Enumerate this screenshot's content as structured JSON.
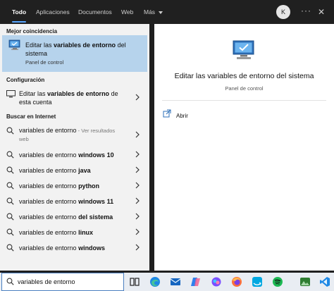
{
  "tabs": [
    {
      "label": "Todo",
      "active": true
    },
    {
      "label": "Aplicaciones"
    },
    {
      "label": "Documentos"
    },
    {
      "label": "Web"
    },
    {
      "label": "Más"
    }
  ],
  "user_initial": "K",
  "more_glyph": "···",
  "close_glyph": "✕",
  "sections": {
    "best_match": "Mejor coincidencia",
    "settings": "Configuración",
    "web": "Buscar en Internet"
  },
  "best_match": {
    "title_pre": "Editar las ",
    "title_bold": "variables de entorno",
    "title_post": " del sistema",
    "subtitle": "Panel de control"
  },
  "settings_item": {
    "title_pre": "Editar las ",
    "title_bold": "variables de entorno",
    "title_post": " de esta cuenta"
  },
  "web_results": [
    {
      "prefix": "variables de entorno",
      "bold": "",
      "hint": " - Ver resultados",
      "hint2": "web"
    },
    {
      "prefix": "variables de entorno ",
      "bold": "windows 10"
    },
    {
      "prefix": "variables de entorno ",
      "bold": "java"
    },
    {
      "prefix": "variables de entorno ",
      "bold": "python"
    },
    {
      "prefix": "variables de entorno ",
      "bold": "windows 11"
    },
    {
      "prefix": "variables de entorno ",
      "bold": "del sistema"
    },
    {
      "prefix": "variables de entorno ",
      "bold": "linux"
    },
    {
      "prefix": "variables de entorno ",
      "bold": "windows"
    }
  ],
  "detail": {
    "title": "Editar las variables de entorno del sistema",
    "subtitle": "Panel de control",
    "action_open": "Abrir"
  },
  "search": {
    "query": "variables de entorno"
  },
  "taskbar_icons": [
    "task-view-icon",
    "edge-icon",
    "mail-icon",
    "copilot-icon",
    "firefox-icon",
    "prime-video-icon",
    "spotify-icon",
    "photos-icon",
    "vscode-icon"
  ],
  "colors": {
    "accent": "#58a6ff",
    "selection": "#b6d3ec"
  }
}
